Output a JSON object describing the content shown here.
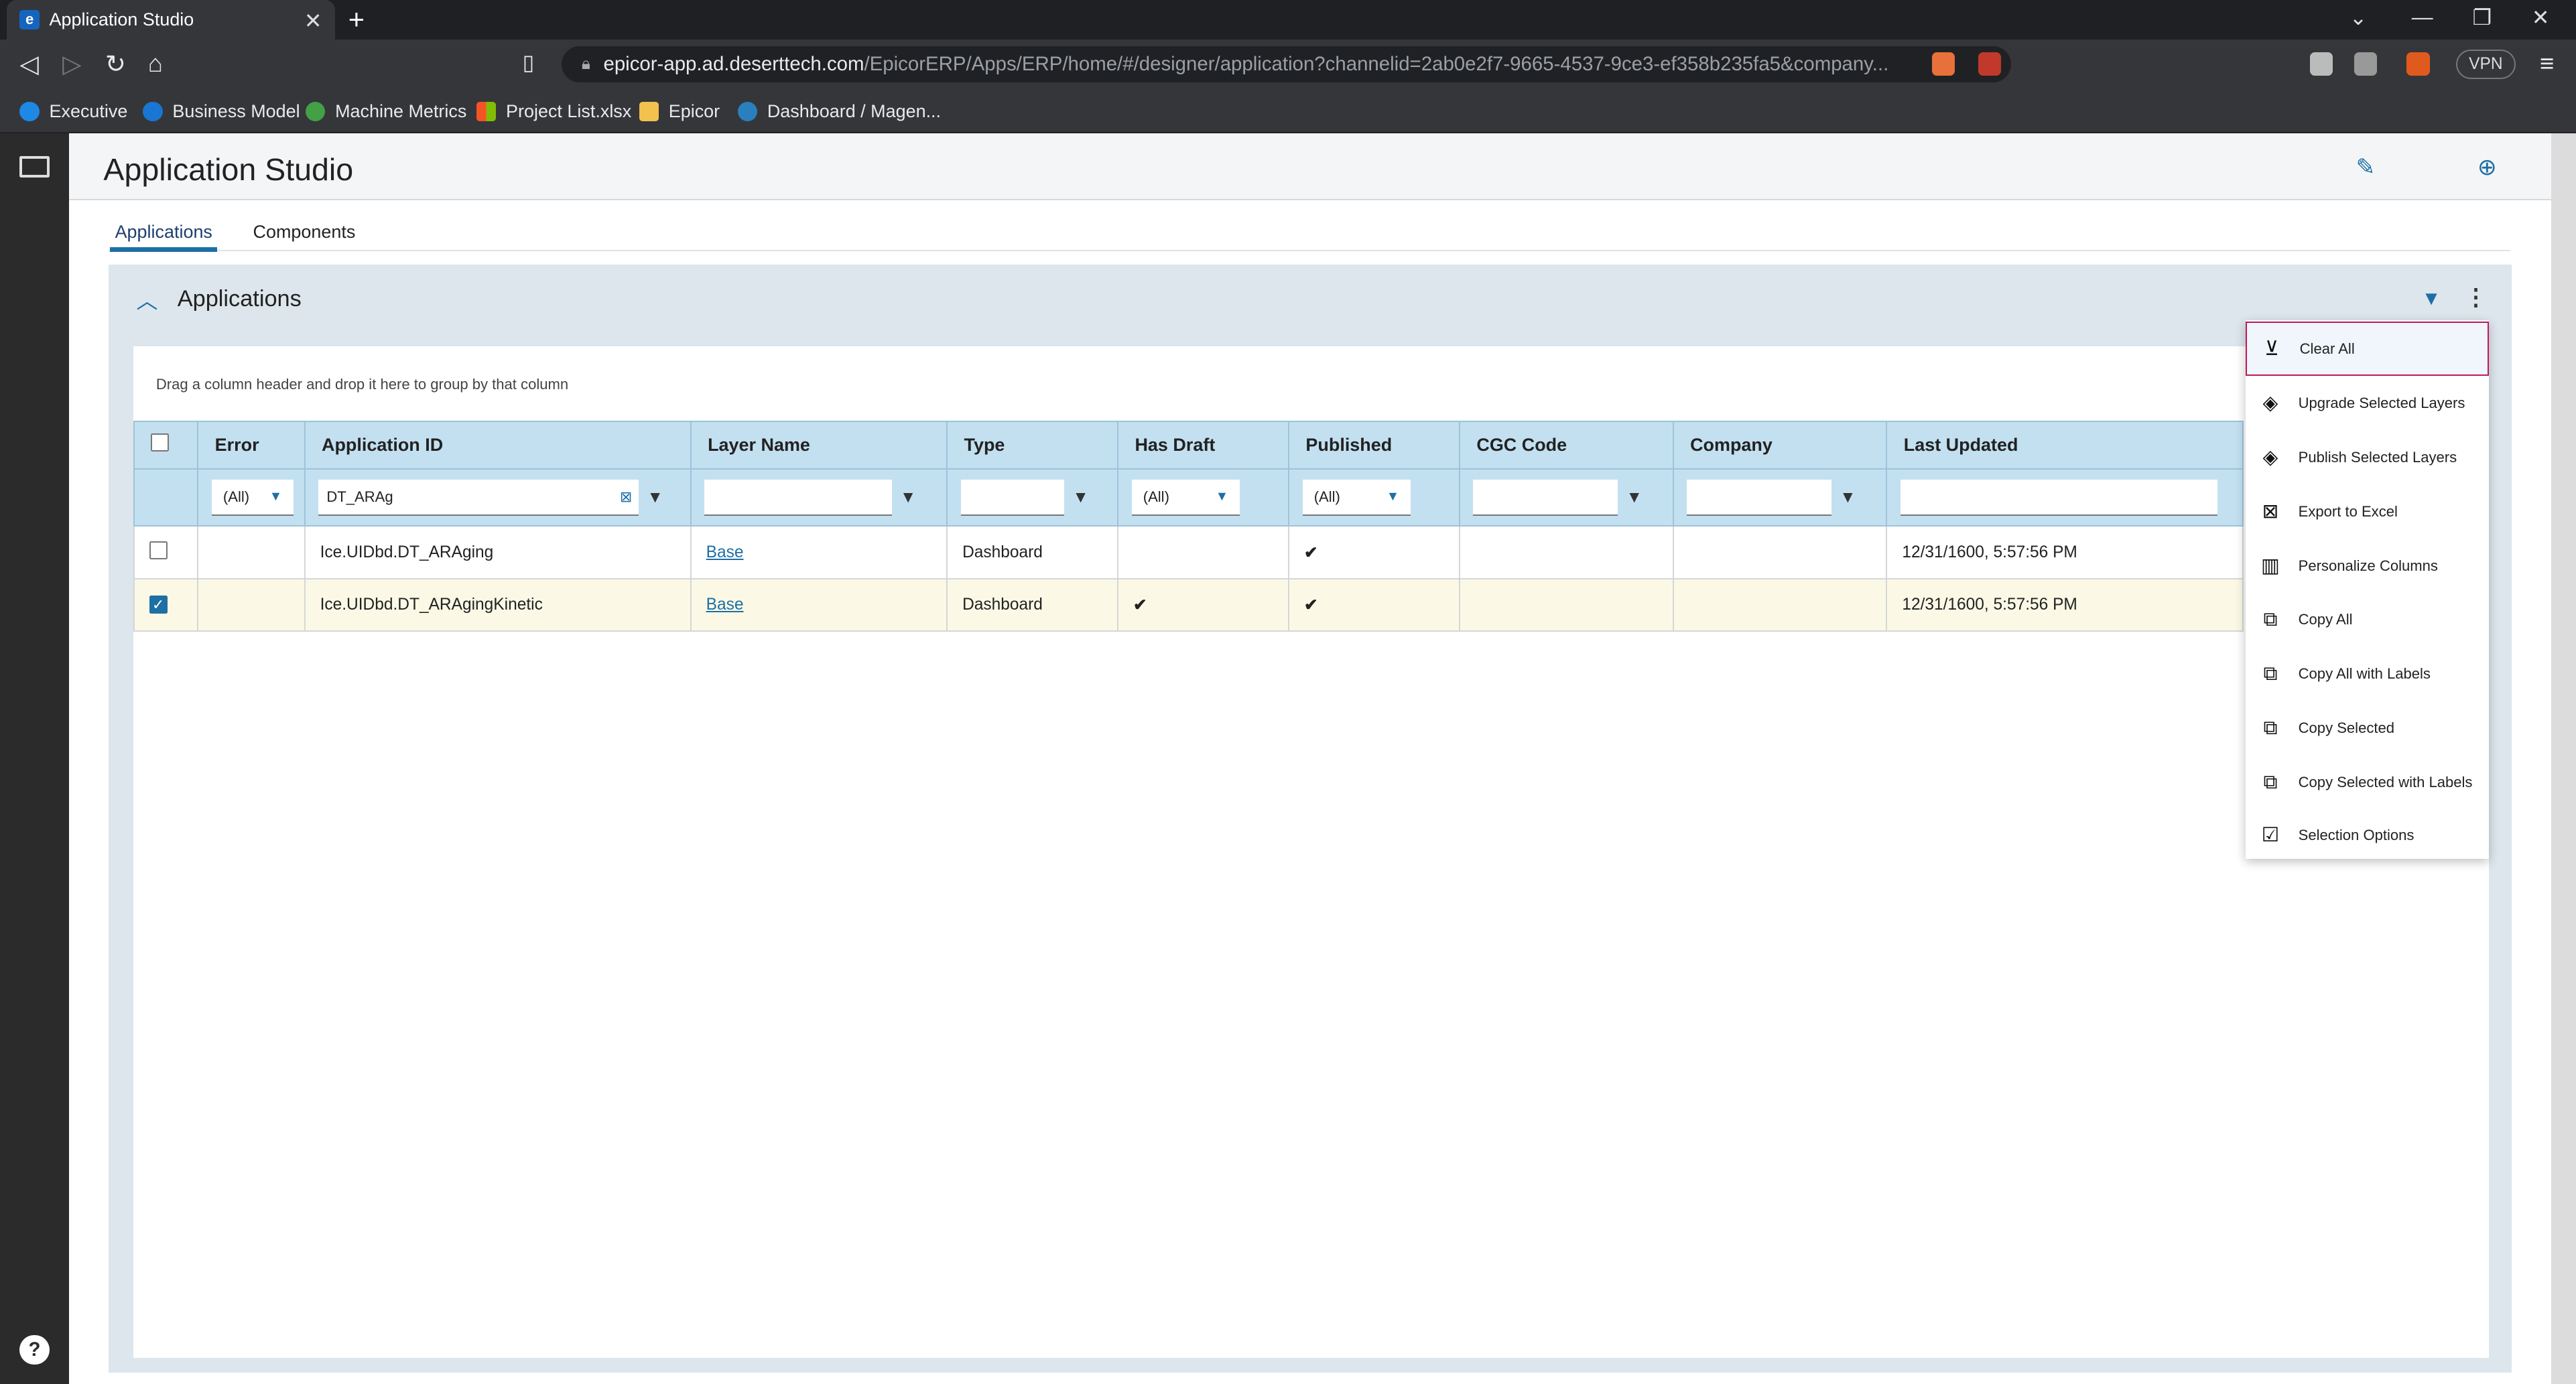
{
  "browser": {
    "tab_title": "Application Studio",
    "tab_favicon": "e",
    "url_host": "epicor-app.ad.deserttech.com",
    "url_path": "/EpicorERP/Apps/ERP/home/#/designer/application?channelid=2ab0e2f7-9665-4537-9ce3-ef358b235fa5&company...",
    "vpn_label": "VPN",
    "bookmarks": [
      "Executive",
      "Business Model",
      "Machine Metrics",
      "Project List.xlsx",
      "Epicor",
      "Dashboard / Magen..."
    ]
  },
  "app": {
    "title": "Application Studio",
    "tabs": [
      "Applications",
      "Components"
    ],
    "panel_title": "Applications",
    "group_hint": "Drag a column header and drop it here to group by that column"
  },
  "grid": {
    "columns": [
      "Error",
      "Application ID",
      "Layer Name",
      "Type",
      "Has Draft",
      "Published",
      "CGC Code",
      "Company",
      "Last Updated"
    ],
    "filters": {
      "error": "(All)",
      "application_id": "DT_ARAg",
      "has_draft": "(All)",
      "published": "(All)"
    },
    "rows": [
      {
        "selected": false,
        "application_id": "Ice.UIDbd.DT_ARAging",
        "layer_name": "Base",
        "type": "Dashboard",
        "has_draft": "",
        "published": "✔",
        "last_updated": "12/31/1600, 5:57:56 PM"
      },
      {
        "selected": true,
        "application_id": "Ice.UIDbd.DT_ARAgingKinetic",
        "layer_name": "Base",
        "type": "Dashboard",
        "has_draft": "✔",
        "published": "✔",
        "last_updated": "12/31/1600, 5:57:56 PM"
      }
    ]
  },
  "context_menu": {
    "items": [
      "Clear All",
      "Upgrade Selected Layers",
      "Publish Selected Layers",
      "Export to Excel",
      "Personalize Columns",
      "Copy All",
      "Copy All with Labels",
      "Copy Selected",
      "Copy Selected with Labels",
      "Selection Options"
    ]
  },
  "colors": {
    "accent": "#1d6fa5",
    "header_blue": "#c3e0f1",
    "panel_bg": "#dce6ec",
    "selected_row": "#fbf9e6",
    "menu_highlight_border": "#c2185b"
  }
}
